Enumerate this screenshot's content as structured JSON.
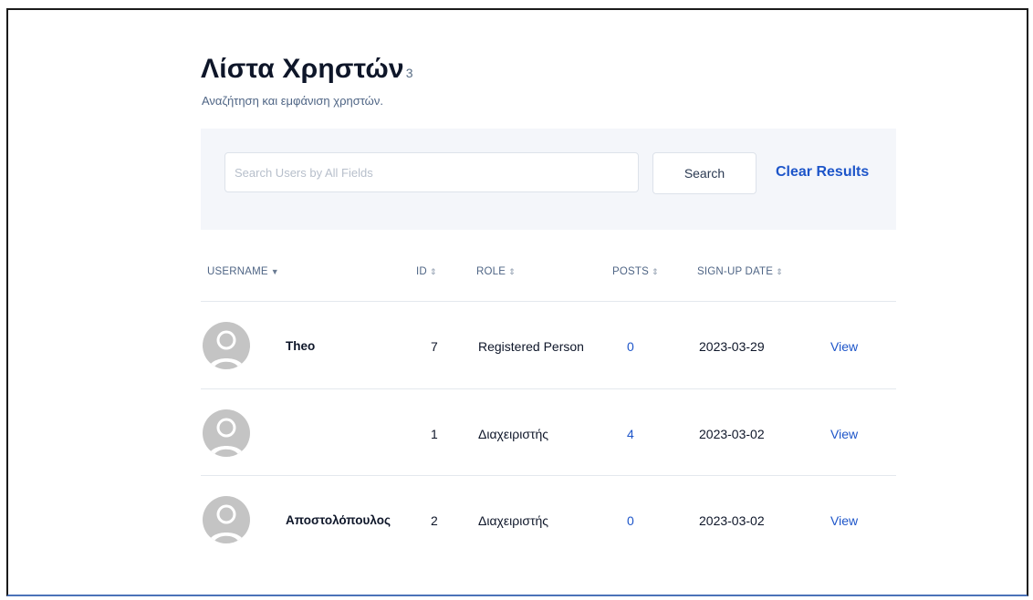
{
  "header": {
    "title": "Λίστα Χρηστών",
    "count": "3",
    "subtitle": "Αναζήτηση και εμφάνιση χρηστών."
  },
  "search": {
    "placeholder": "Search Users by All Fields",
    "value": "",
    "button_label": "Search",
    "clear_label": "Clear Results"
  },
  "table": {
    "columns": [
      {
        "label": "USERNAME",
        "sort": "caret-down-icon"
      },
      {
        "label": "ID",
        "sort": "sort-updown-icon"
      },
      {
        "label": "ROLE",
        "sort": "sort-updown-icon"
      },
      {
        "label": "POSTS",
        "sort": "sort-updown-icon"
      },
      {
        "label": "SIGN-UP DATE",
        "sort": "sort-updown-icon"
      }
    ],
    "rows": [
      {
        "username": "Theo",
        "id": "7",
        "role": "Registered Person",
        "posts": "0",
        "date": "2023-03-29",
        "action": "View"
      },
      {
        "username": "",
        "id": "1",
        "role": "Διαχειριστής",
        "posts": "4",
        "date": "2023-03-02",
        "action": "View"
      },
      {
        "username": "Αποστολόπουλος",
        "id": "2",
        "role": "Διαχειριστής",
        "posts": "0",
        "date": "2023-03-02",
        "action": "View"
      }
    ]
  },
  "colors": {
    "accent": "#1d55c9",
    "panel_bg": "#f4f6fa",
    "avatar_bg": "#c4c4c4"
  }
}
